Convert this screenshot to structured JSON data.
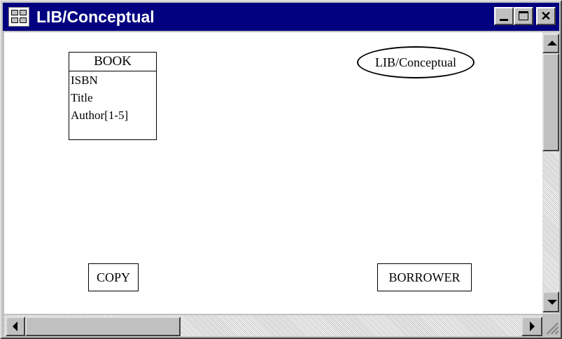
{
  "window": {
    "title": "LIB/Conceptual",
    "app_icon": "diagram-app-icon",
    "controls": {
      "minimize_icon": "minimize-icon",
      "maximize_icon": "maximize-icon",
      "close_icon": "close-icon",
      "close_glyph": "✕"
    }
  },
  "diagram": {
    "book": {
      "name": "BOOK",
      "attributes": [
        "ISBN",
        "Title",
        "Author[1-5]"
      ]
    },
    "copy": {
      "name": "COPY"
    },
    "borrower": {
      "name": "BORROWER"
    },
    "model_label": "LIB/Conceptual"
  },
  "scrollbars": {
    "vertical": {
      "up_icon": "scroll-up-icon",
      "down_icon": "scroll-down-icon"
    },
    "horizontal": {
      "left_icon": "scroll-left-icon",
      "right_icon": "scroll-right-icon"
    }
  },
  "colors": {
    "titlebar": "#000080",
    "title_text": "#ffffff",
    "canvas": "#ffffff",
    "chrome": "#c0c0c0"
  }
}
